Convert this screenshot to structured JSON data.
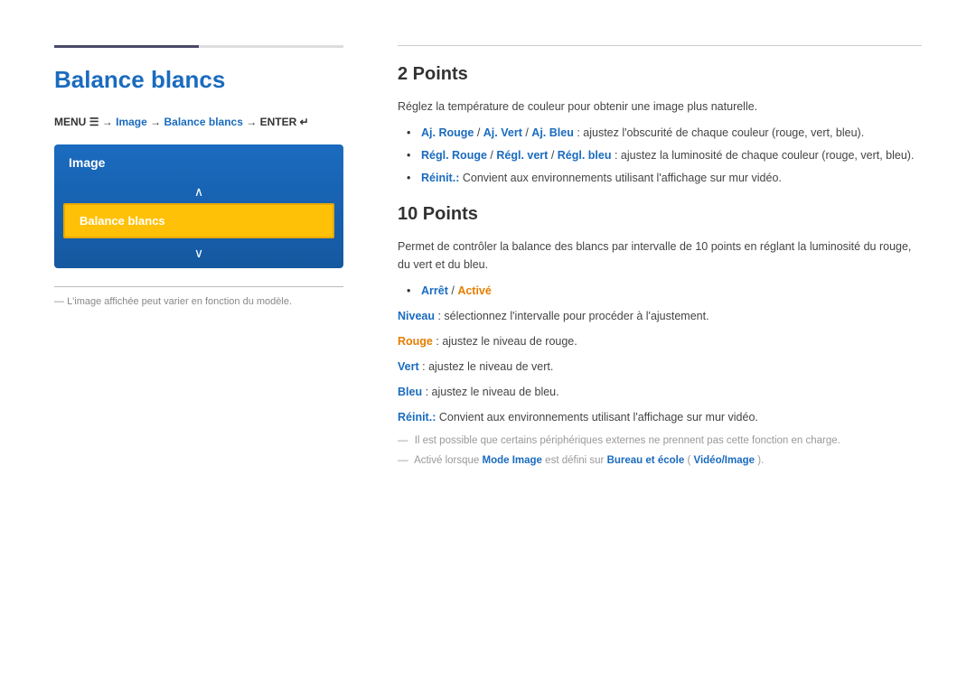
{
  "page": {
    "top_border_color_left": "#4a4a6a",
    "top_border_color_right": "#dddddd"
  },
  "left": {
    "title": "Balance blancs",
    "menu_nav": {
      "menu": "MENU",
      "arrow1": "→",
      "image": "Image",
      "arrow2": "→",
      "balance": "Balance blancs",
      "arrow3": "→",
      "enter": "ENTER"
    },
    "menu_box": {
      "header": "Image",
      "up_arrow": "∧",
      "selected": "Balance blancs",
      "down_arrow": "∨"
    },
    "footnote": "L'image affichée peut varier en fonction du modèle."
  },
  "right": {
    "section1": {
      "title": "2 Points",
      "desc": "Réglez la température de couleur pour obtenir une image plus naturelle.",
      "bullets": [
        {
          "blue_parts": [
            "Aj. Rouge",
            "Aj. Vert",
            "Aj. Bleu"
          ],
          "separators": [
            " / ",
            " / "
          ],
          "suffix": " : ajustez l'obscurité de chaque couleur (rouge, vert, bleu)."
        },
        {
          "blue_parts": [
            "Régl. Rouge",
            "Régl. vert",
            "Régl. bleu"
          ],
          "separators": [
            " / ",
            " / "
          ],
          "suffix": " : ajustez la luminosité de chaque couleur (rouge, vert, bleu)."
        },
        {
          "blue_parts": [
            "Réinit.:"
          ],
          "suffix": " Convient aux environnements utilisant l'affichage sur mur vidéo."
        }
      ]
    },
    "section2": {
      "title": "10 Points",
      "intro": "Permet de contrôler la balance des blancs par intervalle de 10 points en réglant la luminosité du rouge, du vert et du bleu.",
      "bullet_arret": "Arrêt",
      "bullet_sep": " / ",
      "bullet_active": "Activé",
      "niveau_label": "Niveau",
      "niveau_text": " : sélectionnez l'intervalle pour procéder à l'ajustement.",
      "rouge_label": "Rouge",
      "rouge_text": " : ajustez le niveau de rouge.",
      "vert_label": "Vert",
      "vert_text": " : ajustez le niveau de vert.",
      "bleu_label": "Bleu",
      "bleu_text": " : ajustez le niveau de bleu.",
      "reinit_label": "Réinit.:",
      "reinit_text": " Convient aux environnements utilisant l'affichage sur mur vidéo.",
      "note1": "Il est possible que certains périphériques externes ne prennent pas cette fonction en charge.",
      "note2_prefix": "Activé lorsque ",
      "note2_mode": "Mode Image",
      "note2_mid": " est défini sur ",
      "note2_bureau": "Bureau et école",
      "note2_paren_open": " (",
      "note2_video": "Vidéo/Image",
      "note2_paren_close": ")."
    }
  }
}
